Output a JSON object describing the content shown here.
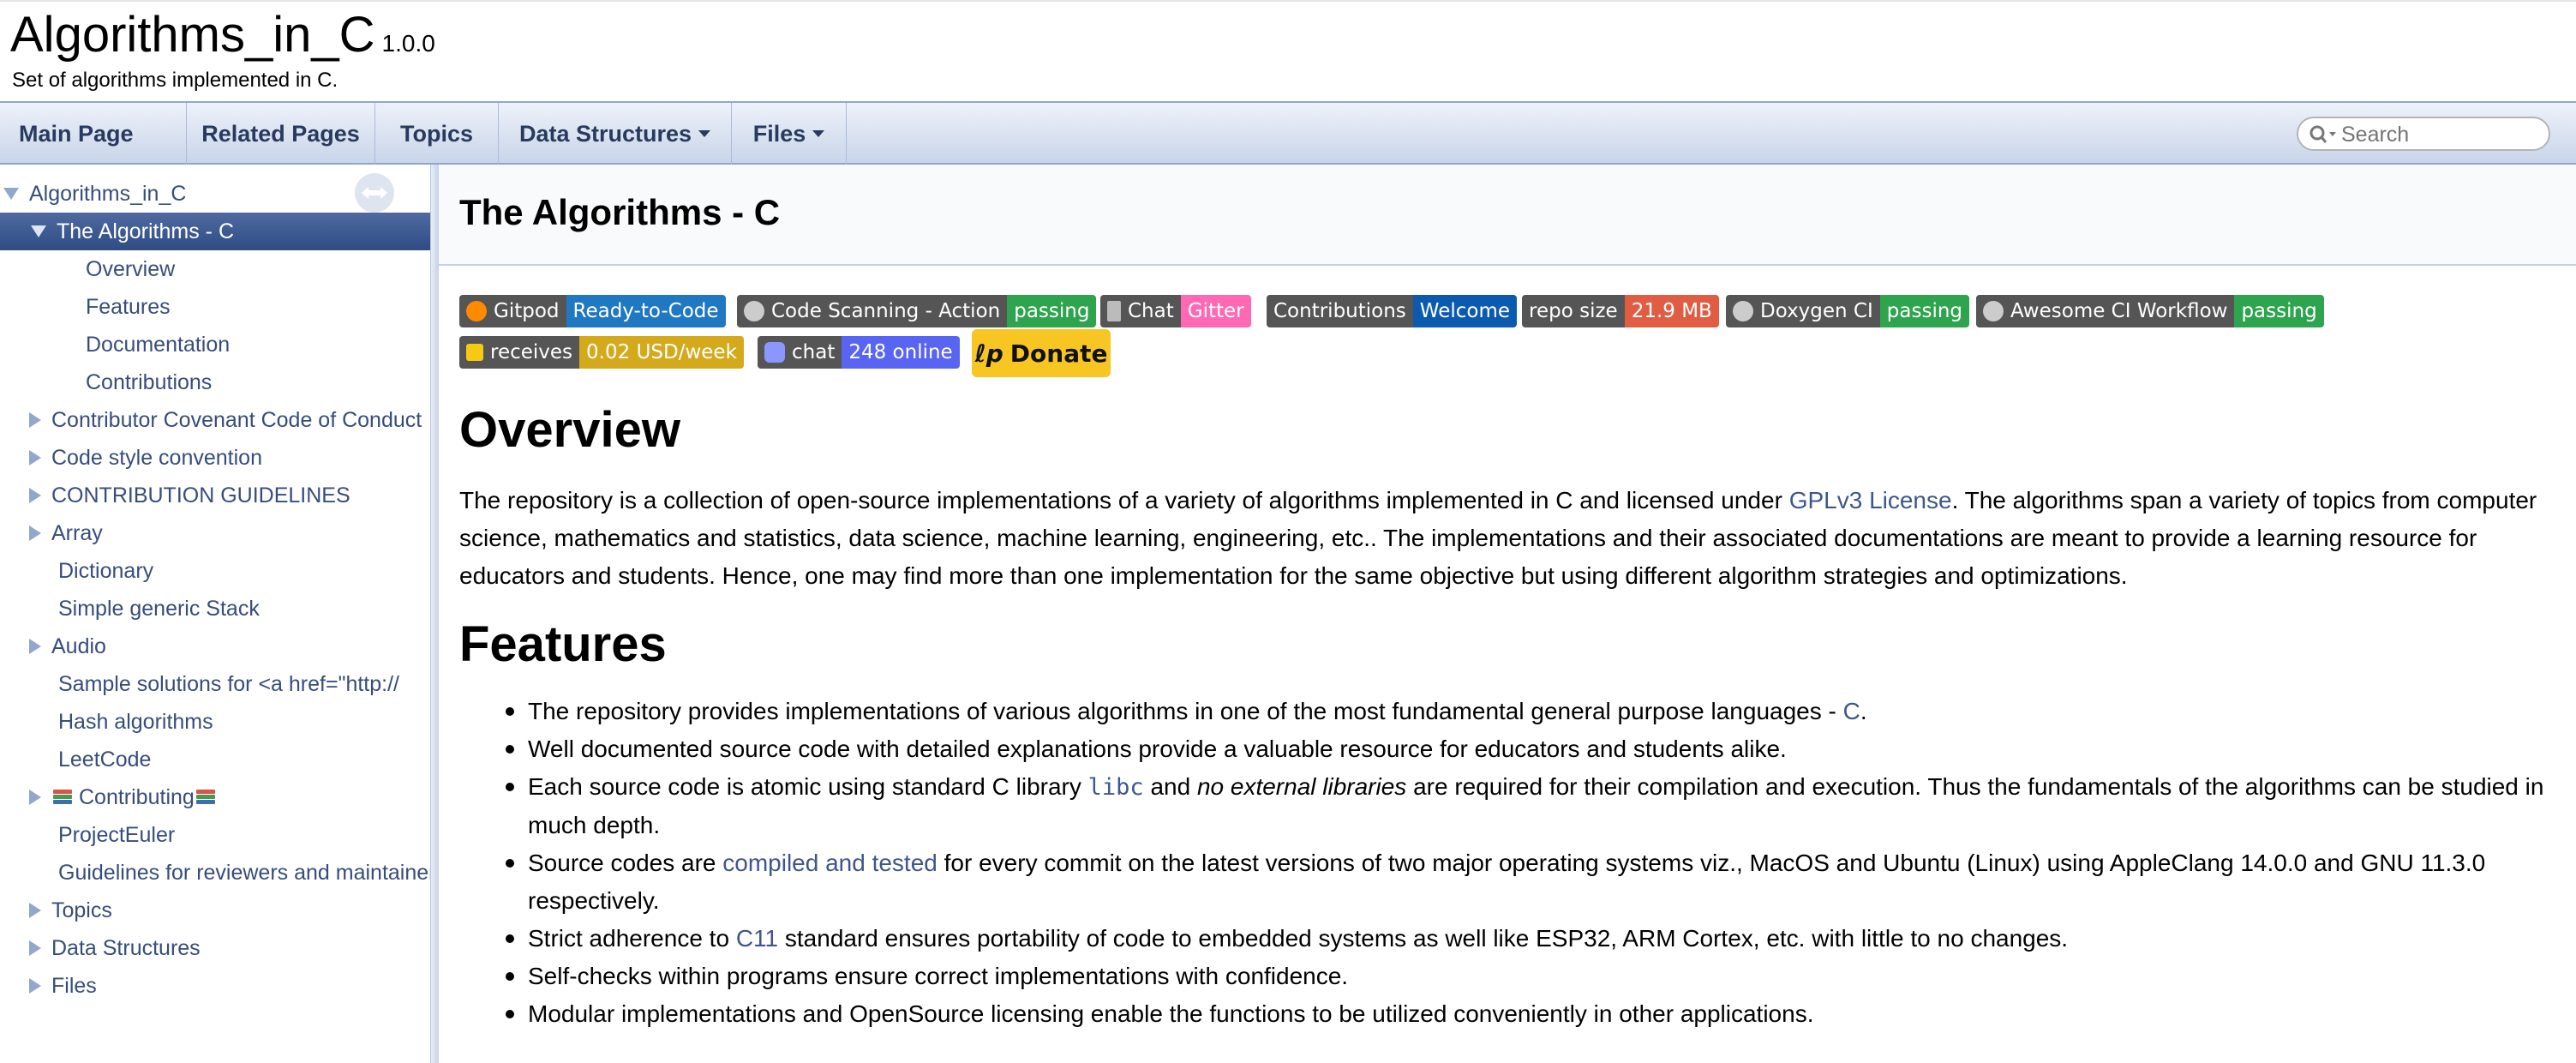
{
  "project": {
    "name": "Algorithms_in_C",
    "number": "1.0.0",
    "brief": "Set of algorithms implemented in C."
  },
  "navbar": {
    "items": [
      "Main Page",
      "Related Pages",
      "Topics",
      "Data Structures",
      "Files"
    ],
    "search_placeholder": "Search"
  },
  "sidenav": {
    "items": [
      {
        "label": "Algorithms_in_C",
        "expander": "down"
      },
      {
        "label": "The Algorithms - C",
        "expander": "down",
        "selected": true
      },
      {
        "label": "Overview"
      },
      {
        "label": "Features"
      },
      {
        "label": "Documentation"
      },
      {
        "label": "Contributions"
      },
      {
        "label": "Contributor Covenant Code of Conduct",
        "expander": "right"
      },
      {
        "label": "Code style convention",
        "expander": "right"
      },
      {
        "label": "CONTRIBUTION GUIDELINES",
        "expander": "right"
      },
      {
        "label": "Array",
        "expander": "right"
      },
      {
        "label": "Dictionary"
      },
      {
        "label": "Simple generic Stack"
      },
      {
        "label": "Audio",
        "expander": "right"
      },
      {
        "label": "Sample solutions for <a href=\"http://"
      },
      {
        "label": "Hash algorithms"
      },
      {
        "label": "LeetCode"
      },
      {
        "label": "Contributing",
        "expander": "right",
        "icon": "books-icon"
      },
      {
        "label": "ProjectEuler"
      },
      {
        "label": "Guidelines for reviewers and maintainers"
      },
      {
        "label": "Topics",
        "expander": "right"
      },
      {
        "label": "Data Structures",
        "expander": "right"
      },
      {
        "label": "Files",
        "expander": "right"
      }
    ]
  },
  "content": {
    "title": "The Algorithms - C",
    "badges": [
      {
        "left": "Gitpod",
        "right": "Ready-to-Code",
        "color": "#1f78c1",
        "icon": "gitpod-icon"
      },
      {
        "left": "Code Scanning - Action",
        "right": "passing",
        "color": "#2ea44f",
        "icon": "github-icon"
      },
      {
        "left": "Chat",
        "right": "Gitter",
        "color": "#ff69b4",
        "icon": "gitter-icon"
      },
      {
        "left": "Contributions",
        "right": "Welcome",
        "color": "#0c5ab0"
      },
      {
        "left": "repo size",
        "right": "21.9 MB",
        "color": "#e05d44"
      },
      {
        "left": "Doxygen CI",
        "right": "passing",
        "color": "#2ea44f",
        "icon": "github-icon"
      },
      {
        "left": "Awesome CI Workflow",
        "right": "passing",
        "color": "#2ea44f",
        "icon": "github-icon"
      },
      {
        "left": "receives",
        "right": "0.02 USD/week",
        "color": "#d4aa1c",
        "icon": "liberapay-icon"
      },
      {
        "left": "chat",
        "right": "248 online",
        "color": "#5865f2",
        "icon": "discord-icon"
      }
    ],
    "donate_label": "Donate",
    "overview": {
      "heading": "Overview",
      "text_before_link": "The repository is a collection of open-source implementations of a variety of algorithms implemented in C and licensed under ",
      "link": "GPLv3 License",
      "text_after_link": ". The algorithms span a variety of topics from computer science, mathematics and statistics, data science, machine learning, engineering, etc.. The implementations and their associated documentations are meant to provide a learning resource for educators and students. Hence, one may find more than one implementation for the same objective but using different algorithm strategies and optimizations."
    },
    "features": {
      "heading": "Features",
      "item1_text": "The repository provides implementations of various algorithms in one of the most fundamental general purpose languages - ",
      "item1_link": "C",
      "item1_end": ".",
      "item2_text": "Well documented source code with detailed explanations provide a valuable resource for educators and students alike.",
      "item3_a": "Each source code is atomic using standard C library ",
      "item3_code": "libc",
      "item3_b": " and ",
      "item3_em": "no external libraries",
      "item3_c": " are required for their compilation and execution. Thus the fundamentals of the algorithms can be studied in much depth.",
      "item4_a": "Source codes are ",
      "item4_link": "compiled and tested",
      "item4_b": " for every commit on the latest versions of two major operating systems viz., MacOS and Ubuntu (Linux) using AppleClang 14.0.0 and GNU 11.3.0 respectively.",
      "item5_a": "Strict adherence to ",
      "item5_link": "C11",
      "item5_b": " standard ensures portability of code to embedded systems as well like ESP32, ARM Cortex, etc. with little to no changes.",
      "item6_text": "Self-checks within programs ensure correct implementations with confidence.",
      "item7_text": "Modular implementations and OpenSource licensing enable the functions to be utilized conveniently in other applications."
    }
  }
}
